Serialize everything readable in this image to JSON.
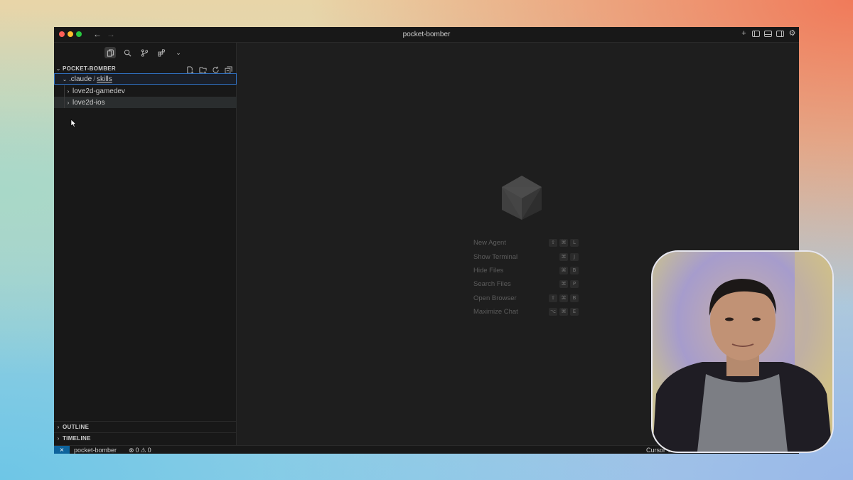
{
  "window": {
    "title": "pocket-bomber"
  },
  "sidebar": {
    "root_label": "POCKET-BOMBER",
    "tree": {
      "folder": ".claude",
      "separator": "/",
      "subfolder": "skills",
      "items": [
        {
          "label": "love2d-gamedev"
        },
        {
          "label": "love2d-ios"
        }
      ]
    },
    "outline_label": "OUTLINE",
    "timeline_label": "TIMELINE"
  },
  "editor": {
    "shortcuts": [
      {
        "label": "New Agent",
        "keys": [
          "⇧",
          "⌘",
          "L"
        ]
      },
      {
        "label": "Show Terminal",
        "keys": [
          "⌘",
          "J"
        ]
      },
      {
        "label": "Hide Files",
        "keys": [
          "⌘",
          "B"
        ]
      },
      {
        "label": "Search Files",
        "keys": [
          "⌘",
          "P"
        ]
      },
      {
        "label": "Open Browser",
        "keys": [
          "⇧",
          "⌘",
          "B"
        ]
      },
      {
        "label": "Maximize Chat",
        "keys": [
          "⌥",
          "⌘",
          "E"
        ]
      }
    ]
  },
  "statusbar": {
    "branch": "pocket-bomber",
    "errors": "0",
    "warnings": "0",
    "right_text": "Cursor Tab"
  },
  "icons": {
    "titlebar": [
      "back-arrow-icon",
      "forward-arrow-icon",
      "plus-icon",
      "toggle-sidebar-icon",
      "toggle-panel-icon",
      "toggle-secondary-sidebar-icon",
      "gear-icon"
    ],
    "activity": [
      "files-icon",
      "search-icon",
      "source-control-icon",
      "extensions-icon",
      "chevron-down-icon"
    ],
    "explorer": [
      "new-file-icon",
      "new-folder-icon",
      "refresh-icon",
      "collapse-all-icon"
    ],
    "editor": [
      "cursor-logo-icon"
    ]
  },
  "colors": {
    "accent": "#2f6fbf",
    "remote": "#0e639c",
    "background": "#1e1e1e",
    "sidebar": "#181818"
  }
}
